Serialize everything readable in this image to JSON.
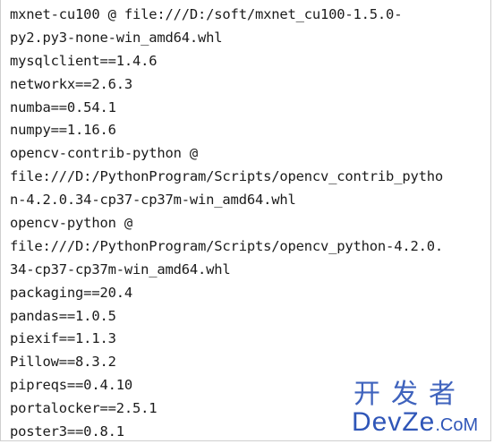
{
  "lines": [
    "mxnet-cu100 @ file:///D:/soft/mxnet_cu100-1.5.0-",
    "py2.py3-none-win_amd64.whl",
    "mysqlclient==1.4.6",
    "networkx==2.6.3",
    "numba==0.54.1",
    "numpy==1.16.6",
    "opencv-contrib-python @",
    "file:///D:/PythonProgram/Scripts/opencv_contrib_pytho",
    "n-4.2.0.34-cp37-cp37m-win_amd64.whl",
    "opencv-python @",
    "file:///D:/PythonProgram/Scripts/opencv_python-4.2.0.",
    "34-cp37-cp37m-win_amd64.whl",
    "packaging==20.4",
    "pandas==1.0.5",
    "piexif==1.1.3",
    "Pillow==8.3.2",
    "pipreqs==0.4.10",
    "portalocker==2.5.1",
    "poster3==0.8.1"
  ],
  "watermark": {
    "cn": "开发者",
    "en_main": "DevZe",
    "en_suffix": ".CoM",
    "color": "#2f56b8"
  }
}
